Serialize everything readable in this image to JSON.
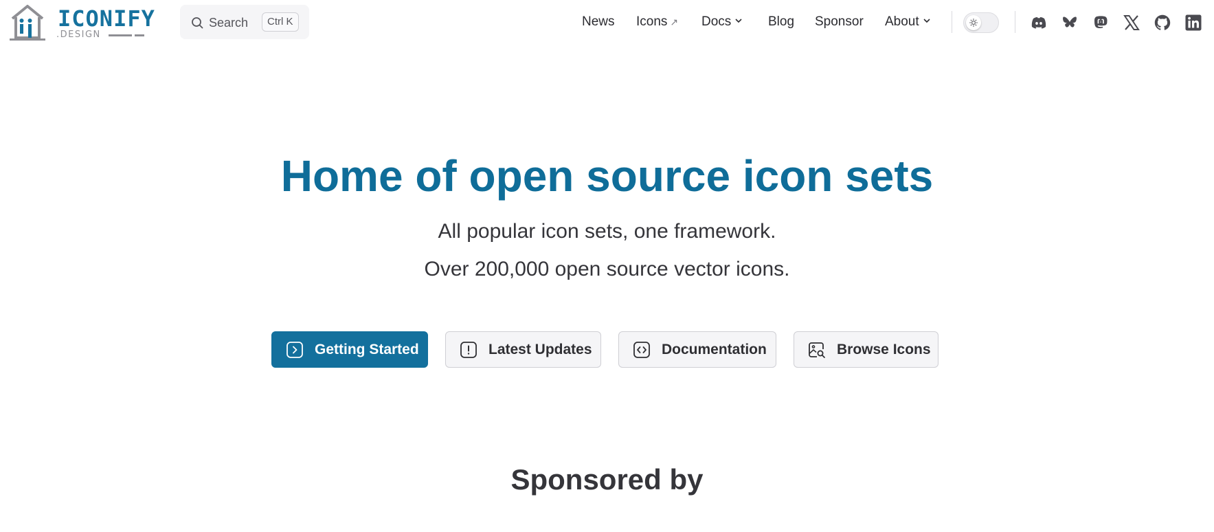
{
  "header": {
    "logo": {
      "word": "ICONIFY",
      "sub": ".DESIGN"
    },
    "search": {
      "label": "Search",
      "shortcut": "Ctrl K"
    },
    "nav": [
      {
        "label": "News"
      },
      {
        "label": "Icons",
        "suffix": "↗"
      },
      {
        "label": "Docs"
      },
      {
        "label": "Blog"
      },
      {
        "label": "Sponsor"
      },
      {
        "label": "About"
      }
    ],
    "social": [
      "discord-icon",
      "bluesky-icon",
      "mastodon-icon",
      "x-icon",
      "github-icon",
      "linkedin-icon"
    ]
  },
  "hero": {
    "title": "Home of open source icon sets",
    "subtitle_line1": "All popular icon sets, one framework.",
    "subtitle_line2": "Over 200,000 open source vector icons."
  },
  "buttons": [
    {
      "label": "Getting Started",
      "icon": "chevron-right-square-icon",
      "style": "primary"
    },
    {
      "label": "Latest Updates",
      "icon": "exclamation-square-icon",
      "style": "secondary"
    },
    {
      "label": "Documentation",
      "icon": "code-square-icon",
      "style": "secondary"
    },
    {
      "label": "Browse Icons",
      "icon": "image-search-icon",
      "style": "secondary"
    }
  ],
  "sponsors": {
    "heading": "Sponsored by"
  },
  "colors": {
    "brand": "#0f6d99",
    "button_primary": "#13709d",
    "text": "#2f2f33",
    "muted": "#8f8f94"
  }
}
